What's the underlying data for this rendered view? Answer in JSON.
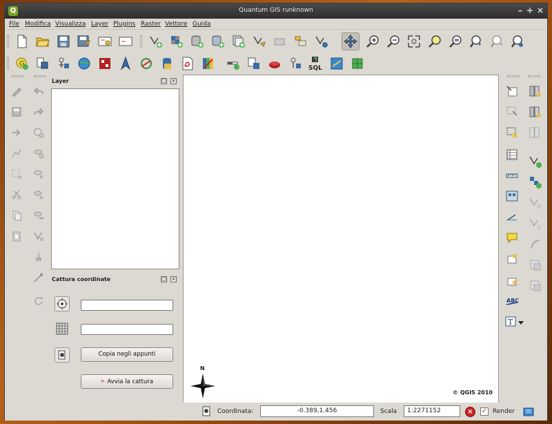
{
  "window": {
    "title": "Quantum GIS runknown",
    "app_icon_letter": "Q"
  },
  "menu": [
    "File",
    "Modifica",
    "Visualizza",
    "Layer",
    "Plugins",
    "Raster",
    "Vettore",
    "Guida"
  ],
  "toolbar_top": [
    "new-project-icon",
    "open-project-icon",
    "save-project-icon",
    "save-as-icon",
    "new-print-composer-icon",
    "composer-manager-icon",
    "add-vector-layer-icon",
    "add-raster-layer-icon",
    "add-postgis-layer-icon",
    "add-spatialite-layer-icon",
    "add-wms-layer-icon",
    "new-vector-layer-icon",
    "remove-layer-icon",
    "add-wfs-layer-icon",
    "add-wcs-layer-icon",
    "pan-icon",
    "zoom-in-icon",
    "zoom-out-icon",
    "zoom-full-icon",
    "zoom-to-selection-icon",
    "zoom-to-layer-icon",
    "zoom-last-icon",
    "zoom-next-icon",
    "refresh-icon"
  ],
  "toolbar_second": [
    "georeferencer-icon",
    "coordinate-capture-icon",
    "gps-icon",
    "openlayers-icon",
    "mapserver-export-icon",
    "north-arrow-icon",
    "copyright-icon",
    "python-console-icon",
    "pdf-export-icon",
    "heatmap-icon",
    "scale-bar-icon",
    "add-delimited-text-icon",
    "plugin-manager-icon",
    "dxf-icon",
    "sql-icon",
    "spreadsheet-icon",
    "graticule-icon"
  ],
  "sql_label": "SQL",
  "layer_panel": {
    "title": "Layer"
  },
  "capture_panel": {
    "title": "Cattura coordinate",
    "field1": "",
    "field2": "",
    "copy_button": "Copia negli appunti",
    "start_button": "Avvia la cattura"
  },
  "map": {
    "north_label": "N",
    "copyright": "© QGIS 2010"
  },
  "status": {
    "coord_label": "Coordinata:",
    "coord_value": "-0.389,1.456",
    "scale_label": "Scala",
    "scale_value": "1:2271152",
    "render_label": "Render",
    "render_checked": true
  },
  "colors": {
    "accent": "#7aa52a",
    "stop_red": "#cc2222",
    "title_bg": "#2e2e2e"
  }
}
